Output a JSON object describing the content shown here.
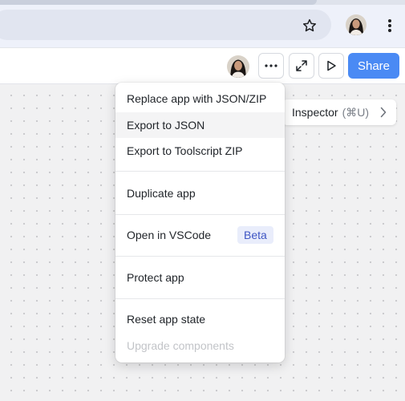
{
  "browser": {
    "star_icon": "star-icon",
    "menu_icon": "kebab-icon"
  },
  "toolbar": {
    "more_icon": "ellipsis-icon",
    "expand_icon": "expand-icon",
    "preview_icon": "play-icon",
    "share_label": "Share"
  },
  "inspector": {
    "label": "Inspector",
    "shortcut": "(⌘U)"
  },
  "menu": {
    "items": [
      {
        "label": "Replace app with JSON/ZIP"
      },
      {
        "label": "Export to JSON"
      },
      {
        "label": "Export to Toolscript ZIP"
      },
      {
        "label": "Duplicate app"
      },
      {
        "label": "Open in VSCode",
        "badge": "Beta"
      },
      {
        "label": "Protect app"
      },
      {
        "label": "Reset app state"
      },
      {
        "label": "Upgrade components"
      }
    ]
  },
  "colors": {
    "accent": "#4a8af4",
    "beta_bg": "#e9edfb",
    "beta_text": "#3f56c4"
  }
}
